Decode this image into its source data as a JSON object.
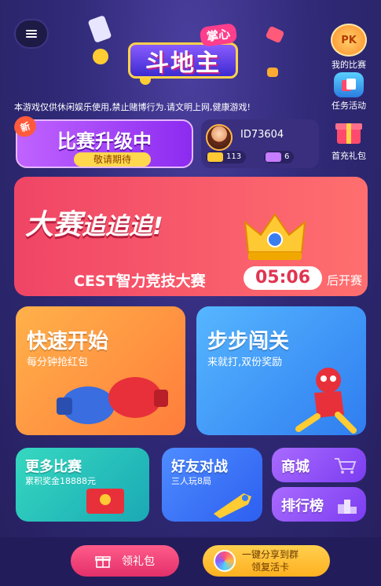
{
  "header": {
    "game_logo": "斗地主",
    "logo_tag": "掌心"
  },
  "notice": "本游戏仅供休闲娱乐使用,禁止赌博行为.请文明上网,健康游戏!",
  "right_menu": [
    {
      "icon": "pk-icon",
      "label": "我的比赛",
      "icon_text": "PK",
      "color": "#ff8c2a"
    },
    {
      "icon": "task-icon",
      "label": "任务活动",
      "color": "#3ab0ff"
    },
    {
      "icon": "gift-box-icon",
      "label": "首充礼包",
      "color": "#ff4a6e"
    }
  ],
  "upgrade_card": {
    "tag": "新",
    "title": "比赛升级中",
    "subtitle": "敬请期待"
  },
  "profile": {
    "id": "ID73604",
    "gold": "113",
    "tickets": "6"
  },
  "banner": {
    "title_prefix": "大赛",
    "title_suffix": "追追追!",
    "event": "CEST智力竞技大赛",
    "countdown": "05:06",
    "after": "后开赛"
  },
  "quick_start": {
    "title": "快速开始",
    "subtitle": "每分钟抢红包"
  },
  "step_challenge": {
    "title": "步步闯关",
    "subtitle": "来就打,双份奖励"
  },
  "more_matches": {
    "title": "更多比赛",
    "subtitle": "累积奖金18888元"
  },
  "friend_battle": {
    "title": "好友对战",
    "subtitle": "三人玩8局"
  },
  "shop": {
    "title": "商城"
  },
  "ranking": {
    "title": "排行榜"
  },
  "bottom": {
    "gift_label": "领礼包",
    "share_line1": "一键分享到群",
    "share_line2": "领复活卡"
  }
}
